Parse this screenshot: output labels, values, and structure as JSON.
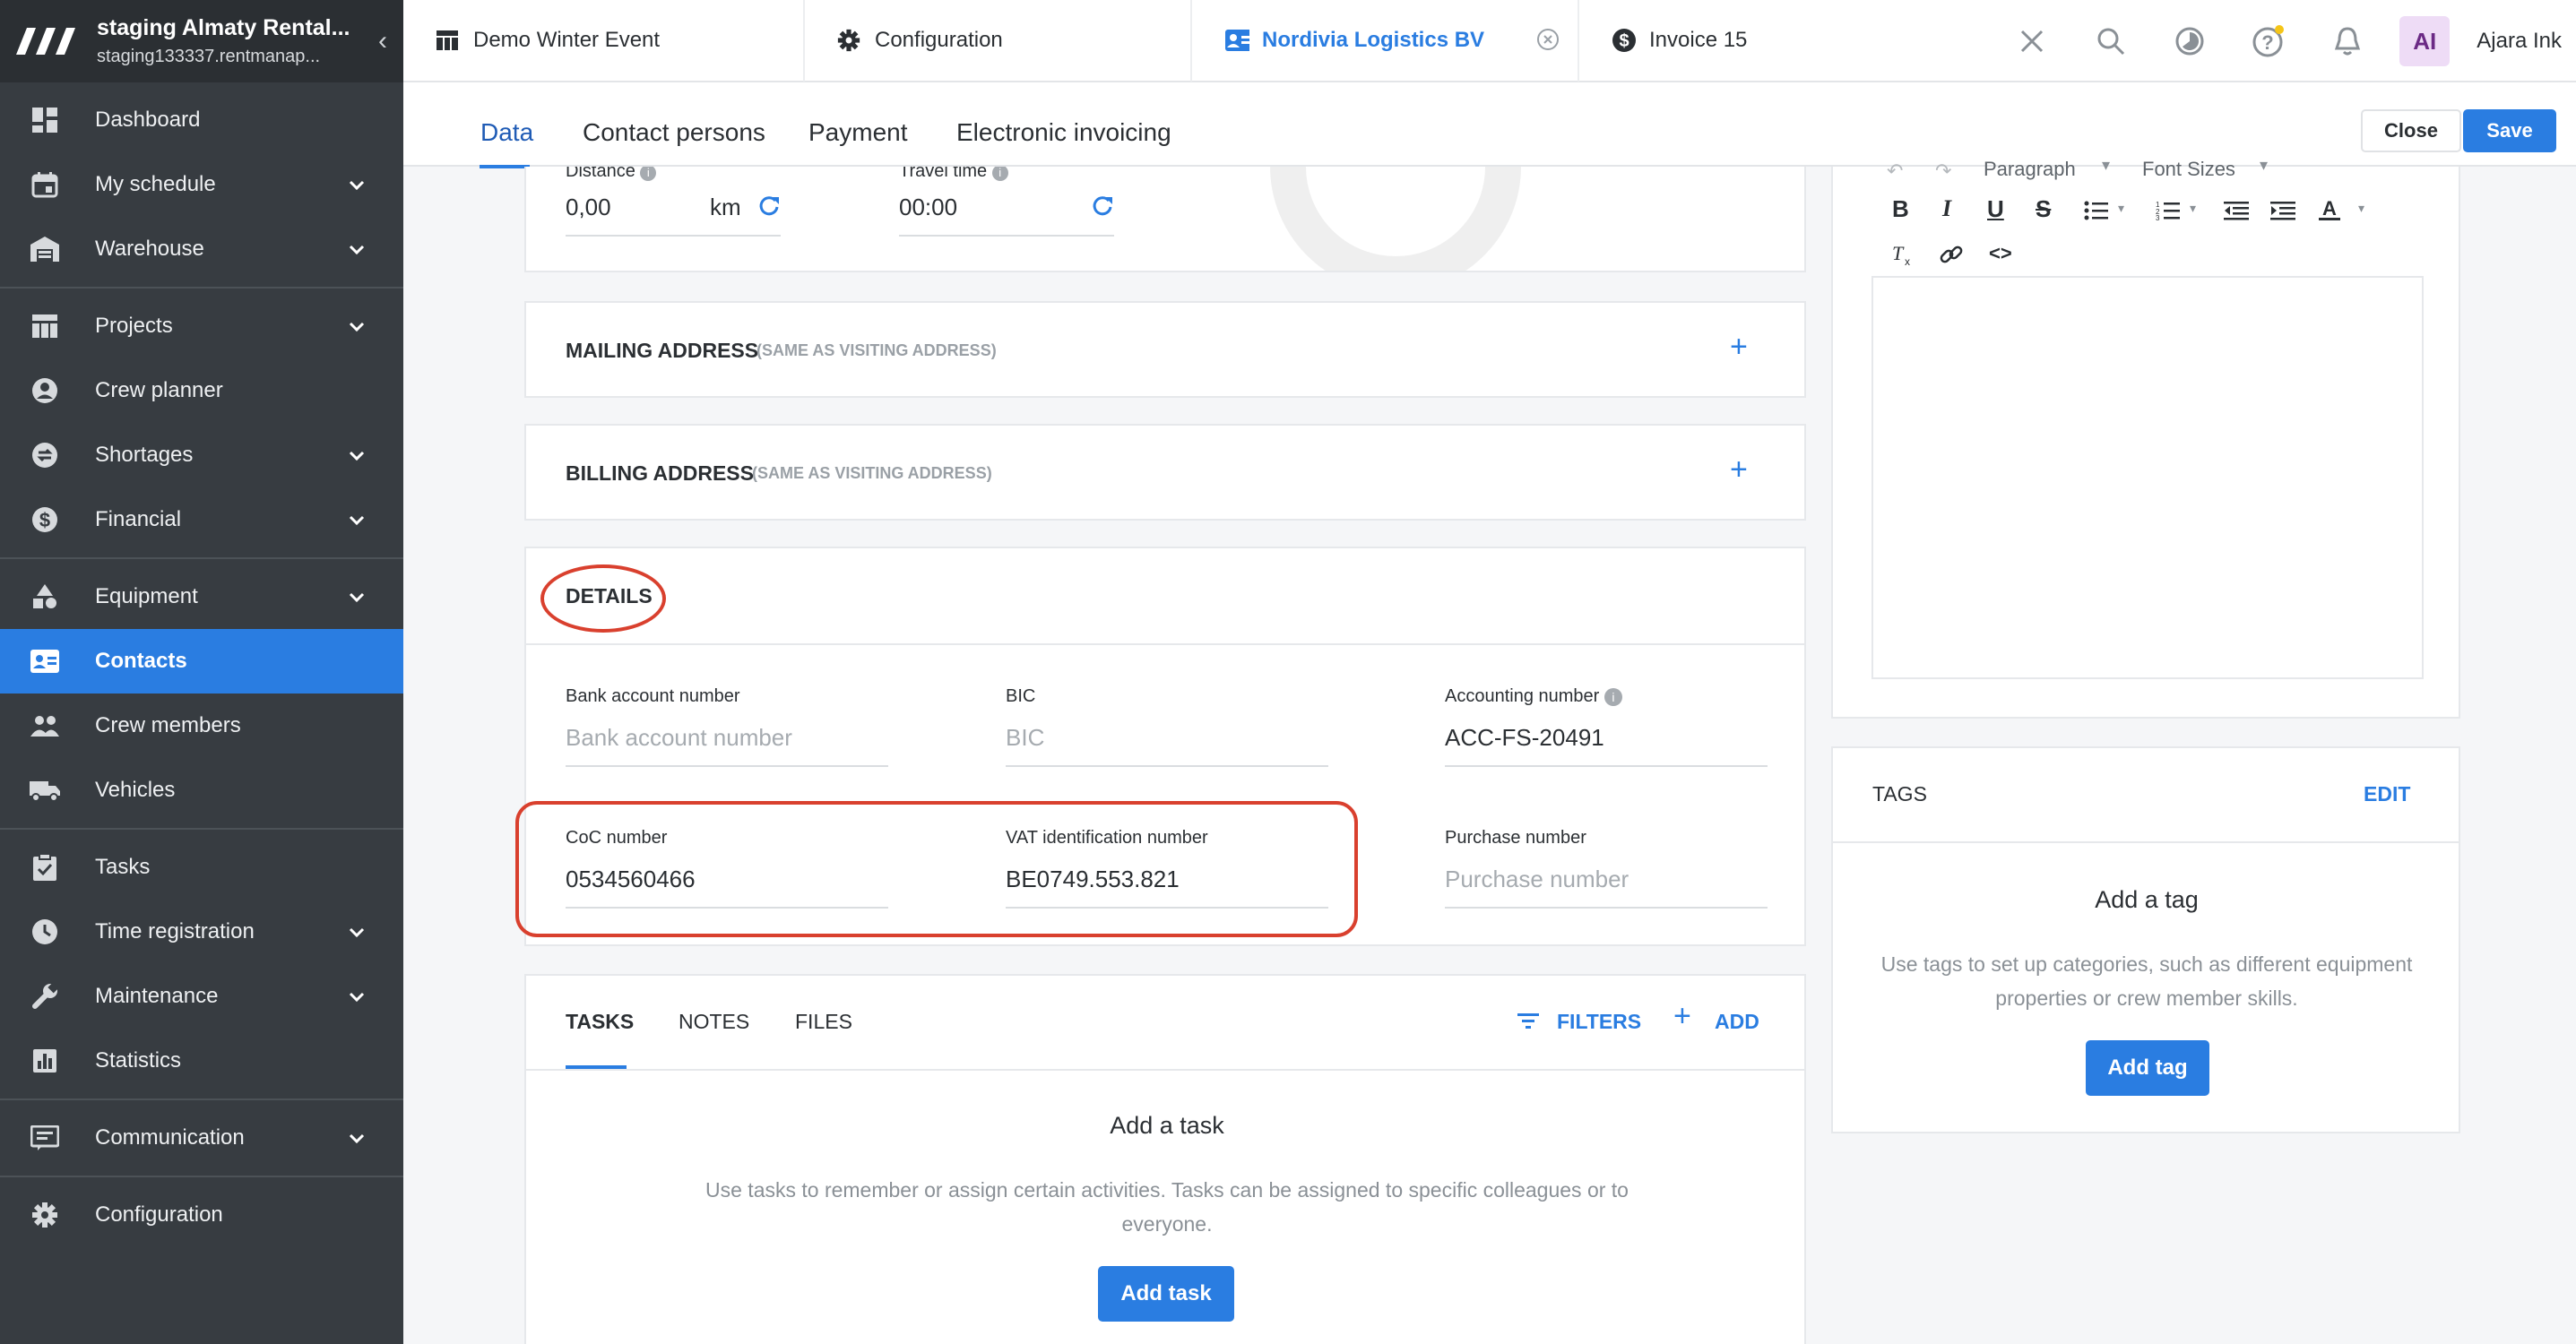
{
  "sidebar": {
    "title": "staging Almaty Rental...",
    "subtitle": "staging133337.rentmanap...",
    "items": [
      {
        "label": "Dashboard"
      },
      {
        "label": "My schedule"
      },
      {
        "label": "Warehouse"
      },
      {
        "label": "Projects"
      },
      {
        "label": "Crew planner"
      },
      {
        "label": "Shortages"
      },
      {
        "label": "Financial"
      },
      {
        "label": "Equipment"
      },
      {
        "label": "Contacts"
      },
      {
        "label": "Crew members"
      },
      {
        "label": "Vehicles"
      },
      {
        "label": "Tasks"
      },
      {
        "label": "Time registration"
      },
      {
        "label": "Maintenance"
      },
      {
        "label": "Statistics"
      },
      {
        "label": "Communication"
      },
      {
        "label": "Configuration"
      }
    ]
  },
  "topbar": {
    "tabs": [
      {
        "label": "Demo Winter Event"
      },
      {
        "label": "Configuration"
      },
      {
        "label": "Nordivia Logistics BV"
      },
      {
        "label": "Invoice 15"
      }
    ],
    "avatar_initials": "AI",
    "user_name": "Ajara Ink"
  },
  "subnav": {
    "tabs": [
      "Data",
      "Contact persons",
      "Payment",
      "Electronic invoicing"
    ],
    "close_label": "Close",
    "save_label": "Save"
  },
  "travel": {
    "distance_label": "Distance",
    "distance_value": "0,00",
    "distance_unit": "km",
    "travel_time_label": "Travel time",
    "travel_time_value": "00:00"
  },
  "mailing": {
    "title": "MAILING ADDRESS",
    "note": "(SAME AS VISITING ADDRESS)"
  },
  "billing": {
    "title": "BILLING ADDRESS",
    "note": "(SAME AS VISITING ADDRESS)"
  },
  "details": {
    "title": "DETAILS",
    "bank_label": "Bank account number",
    "bank_placeholder": "Bank account number",
    "bic_label": "BIC",
    "bic_placeholder": "BIC",
    "accounting_label": "Accounting number",
    "accounting_value": "ACC-FS-20491",
    "coc_label": "CoC number",
    "coc_value": "0534560466",
    "vat_label": "VAT identification number",
    "vat_value": "BE0749.553.821",
    "purchase_label": "Purchase number",
    "purchase_placeholder": "Purchase number"
  },
  "tasks_panel": {
    "tabs": [
      "TASKS",
      "NOTES",
      "FILES"
    ],
    "filters_label": "FILTERS",
    "add_label": "ADD",
    "empty_title": "Add a task",
    "empty_text": "Use tasks to remember or assign certain activities. Tasks can be assigned to specific colleagues or to everyone.",
    "button_label": "Add task"
  },
  "editor": {
    "paragraph_label": "Paragraph",
    "font_sizes_label": "Font Sizes"
  },
  "tags": {
    "title": "TAGS",
    "edit_label": "EDIT",
    "empty_title": "Add a tag",
    "empty_text": "Use tags to set up categories, such as different equipment properties or crew member skills.",
    "button_label": "Add tag"
  },
  "colors": {
    "accent": "#2a7de1",
    "sidebar": "#373c41",
    "annotation": "#d9402e"
  }
}
